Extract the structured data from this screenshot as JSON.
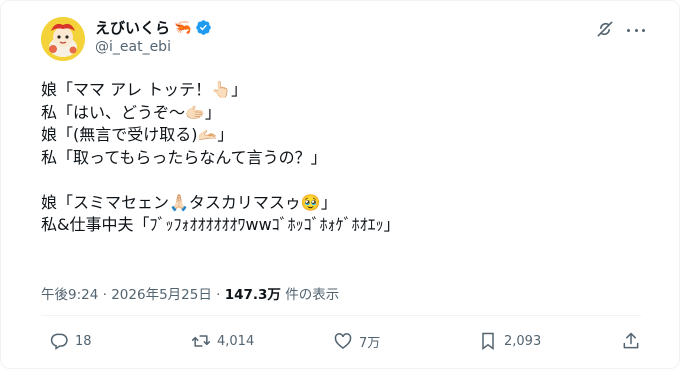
{
  "user": {
    "display_name": "えびいくら",
    "name_emoji": "🦐",
    "handle": "@i_eat_ebi",
    "verified": true
  },
  "icons": {
    "avatar": "avatar-illustration",
    "verified": "verified-badge-icon",
    "grok": "grok-icon",
    "more": "more-icon",
    "reply": "reply-icon",
    "retweet": "retweet-icon",
    "like": "like-icon",
    "bookmark": "bookmark-icon",
    "share": "share-icon"
  },
  "tweet": {
    "lines": [
      "娘「ママ アレ トッテ！👆🏻」",
      "私「はい、どうぞ～🫱🏻」",
      "娘「(無言で受け取る)🫴🏻」",
      "私「取ってもらったらなんて言うの？」",
      "",
      "娘「スミマセェン🙏🏻タスカリマスゥ🥹」",
      "私&仕事中夫「ﾌﾞｯﾌｫｵｵｵｵｵｵﾜwwｺﾞﾎｯｺﾞﾎｫｹﾞﾎｵｴｯ」"
    ]
  },
  "meta": {
    "time": "午後9:24",
    "separator": "·",
    "date": "2026年5月25日",
    "views_count": "147.3万",
    "views_label": "件の表示"
  },
  "actions": {
    "reply_count": "18",
    "retweet_count": "4,014",
    "like_count": "7万",
    "bookmark_count": "2,093"
  },
  "colors": {
    "text": "#0f1419",
    "secondary": "#536471",
    "verified": "#1d9bf0",
    "divider": "#eff3f4",
    "avatar_bg": "#f4d23a"
  }
}
